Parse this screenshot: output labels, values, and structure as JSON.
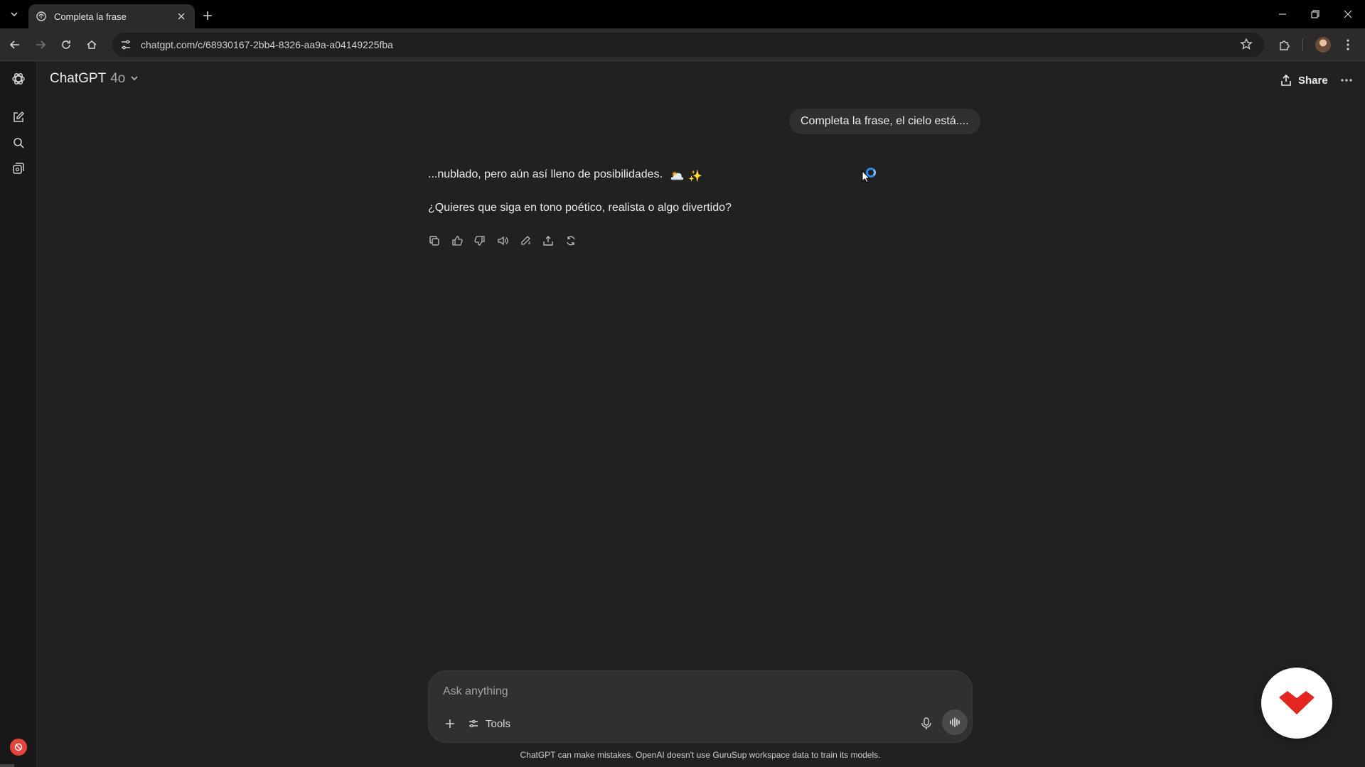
{
  "browser": {
    "tab_title": "Completa la frase",
    "url": "chatgpt.com/c/68930167-2bb4-8326-aa9a-a04149225fba"
  },
  "header": {
    "model_name": "ChatGPT",
    "model_version": "4o",
    "share_label": "Share"
  },
  "conversation": {
    "user_message": "Completa la frase, el cielo está....",
    "assistant_paragraph_1": "...nublado, pero aún así lleno de posibilidades.",
    "assistant_emoji_1": "🌥️",
    "assistant_emoji_2": "✨",
    "assistant_paragraph_2": "¿Quieres que siga en tono poético, realista o algo divertido?"
  },
  "composer": {
    "placeholder": "Ask anything",
    "tools_label": "Tools"
  },
  "footer": {
    "disclaimer": "ChatGPT can make mistakes. OpenAI doesn't use GuruSup workspace data to train its models."
  },
  "colors": {
    "page_background": "#212121",
    "bubble_background": "#303030",
    "spinner_accent": "#2a8af0",
    "badge_red": "#e3261f"
  }
}
